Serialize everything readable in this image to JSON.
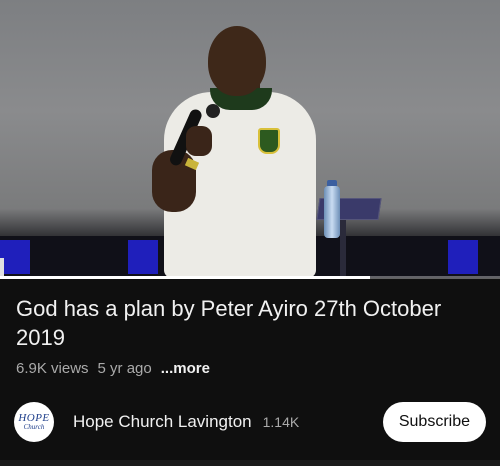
{
  "video": {
    "progress_fraction": 0.74
  },
  "title": "God has a plan by Peter Ayiro 27th October 2019",
  "meta": {
    "views": "6.9K views",
    "age": "5 yr ago",
    "more_label": "...more"
  },
  "channel": {
    "avatar_text_line1": "HOPE",
    "avatar_text_line2": "Church",
    "name": "Hope Church Lavington",
    "subscribers": "1.14K",
    "subscribe_label": "Subscribe"
  },
  "colors": {
    "background": "#0f0f0f",
    "text_primary": "#f1f1f1",
    "text_secondary": "#aaaaaa",
    "subscribe_bg": "#ffffff"
  }
}
